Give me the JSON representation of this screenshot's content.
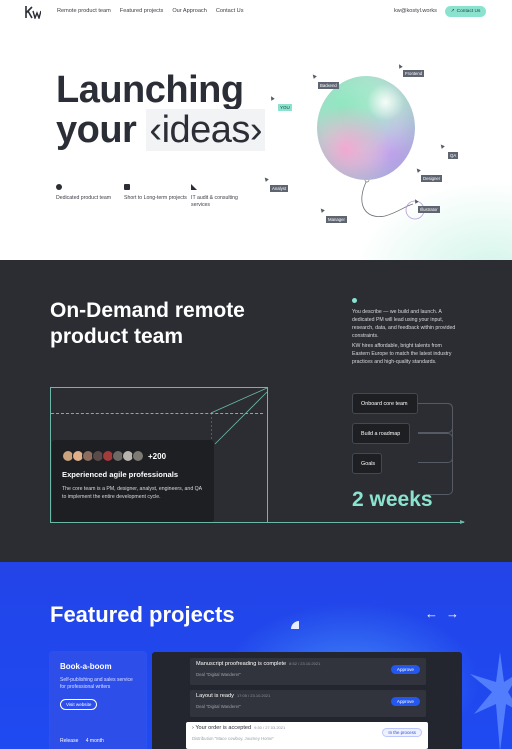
{
  "header": {
    "nav": [
      "Remote product team",
      "Featured projects",
      "Our Approach",
      "Contact Us"
    ],
    "email": "kw@kostyl.works",
    "cta": "Contact Us",
    "cta_icon": "arrow-up-right-icon"
  },
  "hero": {
    "title_line1": "Launching",
    "title_line2_prefix": "your",
    "title_line2_code": "‹ideas›",
    "you_badge": "YOU",
    "features": [
      {
        "label": "Dedicated product team",
        "icon": "circle-icon"
      },
      {
        "label": "Short to Long-term projects",
        "icon": "square-icon"
      },
      {
        "label": "IT audit & consulting services",
        "icon": "triangle-icon"
      }
    ],
    "roles": [
      "Backend",
      "Frontend",
      "QA",
      "Designer",
      "Illustrator",
      "Analyst",
      "Manager"
    ]
  },
  "team": {
    "title": "On-Demand remote product team",
    "para1": "You describe — we build and launch. A dedicated PM will lead using your input, research, data, and feedback within provided constraints.",
    "para2": "KW hires affordable, bright talents from Eastern Europe to match the latest industry practices and high-quality standards.",
    "card_count": "+200",
    "card_title": "Experienced agile professionals",
    "card_desc": "The core team is a PM, designer, analyst, engineers, and QA to implement the entire development cycle.",
    "steps": [
      "Onboard core team",
      "Build a roadmap",
      "Goals"
    ],
    "duration": "2 weeks",
    "accent": "#8be3cf"
  },
  "projects": {
    "title": "Featured projects",
    "prev_icon": "arrow-left-icon",
    "next_icon": "arrow-right-icon",
    "card": {
      "name": "Book-a-boom",
      "desc": "Self-publishing and sales service for professional writers",
      "visit": "Visit website",
      "release_label": "Release",
      "release_value": "4 month"
    },
    "rows": [
      {
        "title": "Manuscript proofreading is complete",
        "date": "8:52 / 23.10.2021",
        "sub": "Deal \"Digital Wanderer\"",
        "action": "Approve"
      },
      {
        "title": "Layout is ready",
        "date": "17:05 / 23.10.2021",
        "sub": "Deal \"Digital Wanderer\"",
        "action": "Approve"
      },
      {
        "title": "Your order is accepted",
        "date": "9:30 / 27.03.2021",
        "sub": "Distribution \"Mace cowboy. Journey Home\"",
        "action": "In the process"
      }
    ]
  }
}
